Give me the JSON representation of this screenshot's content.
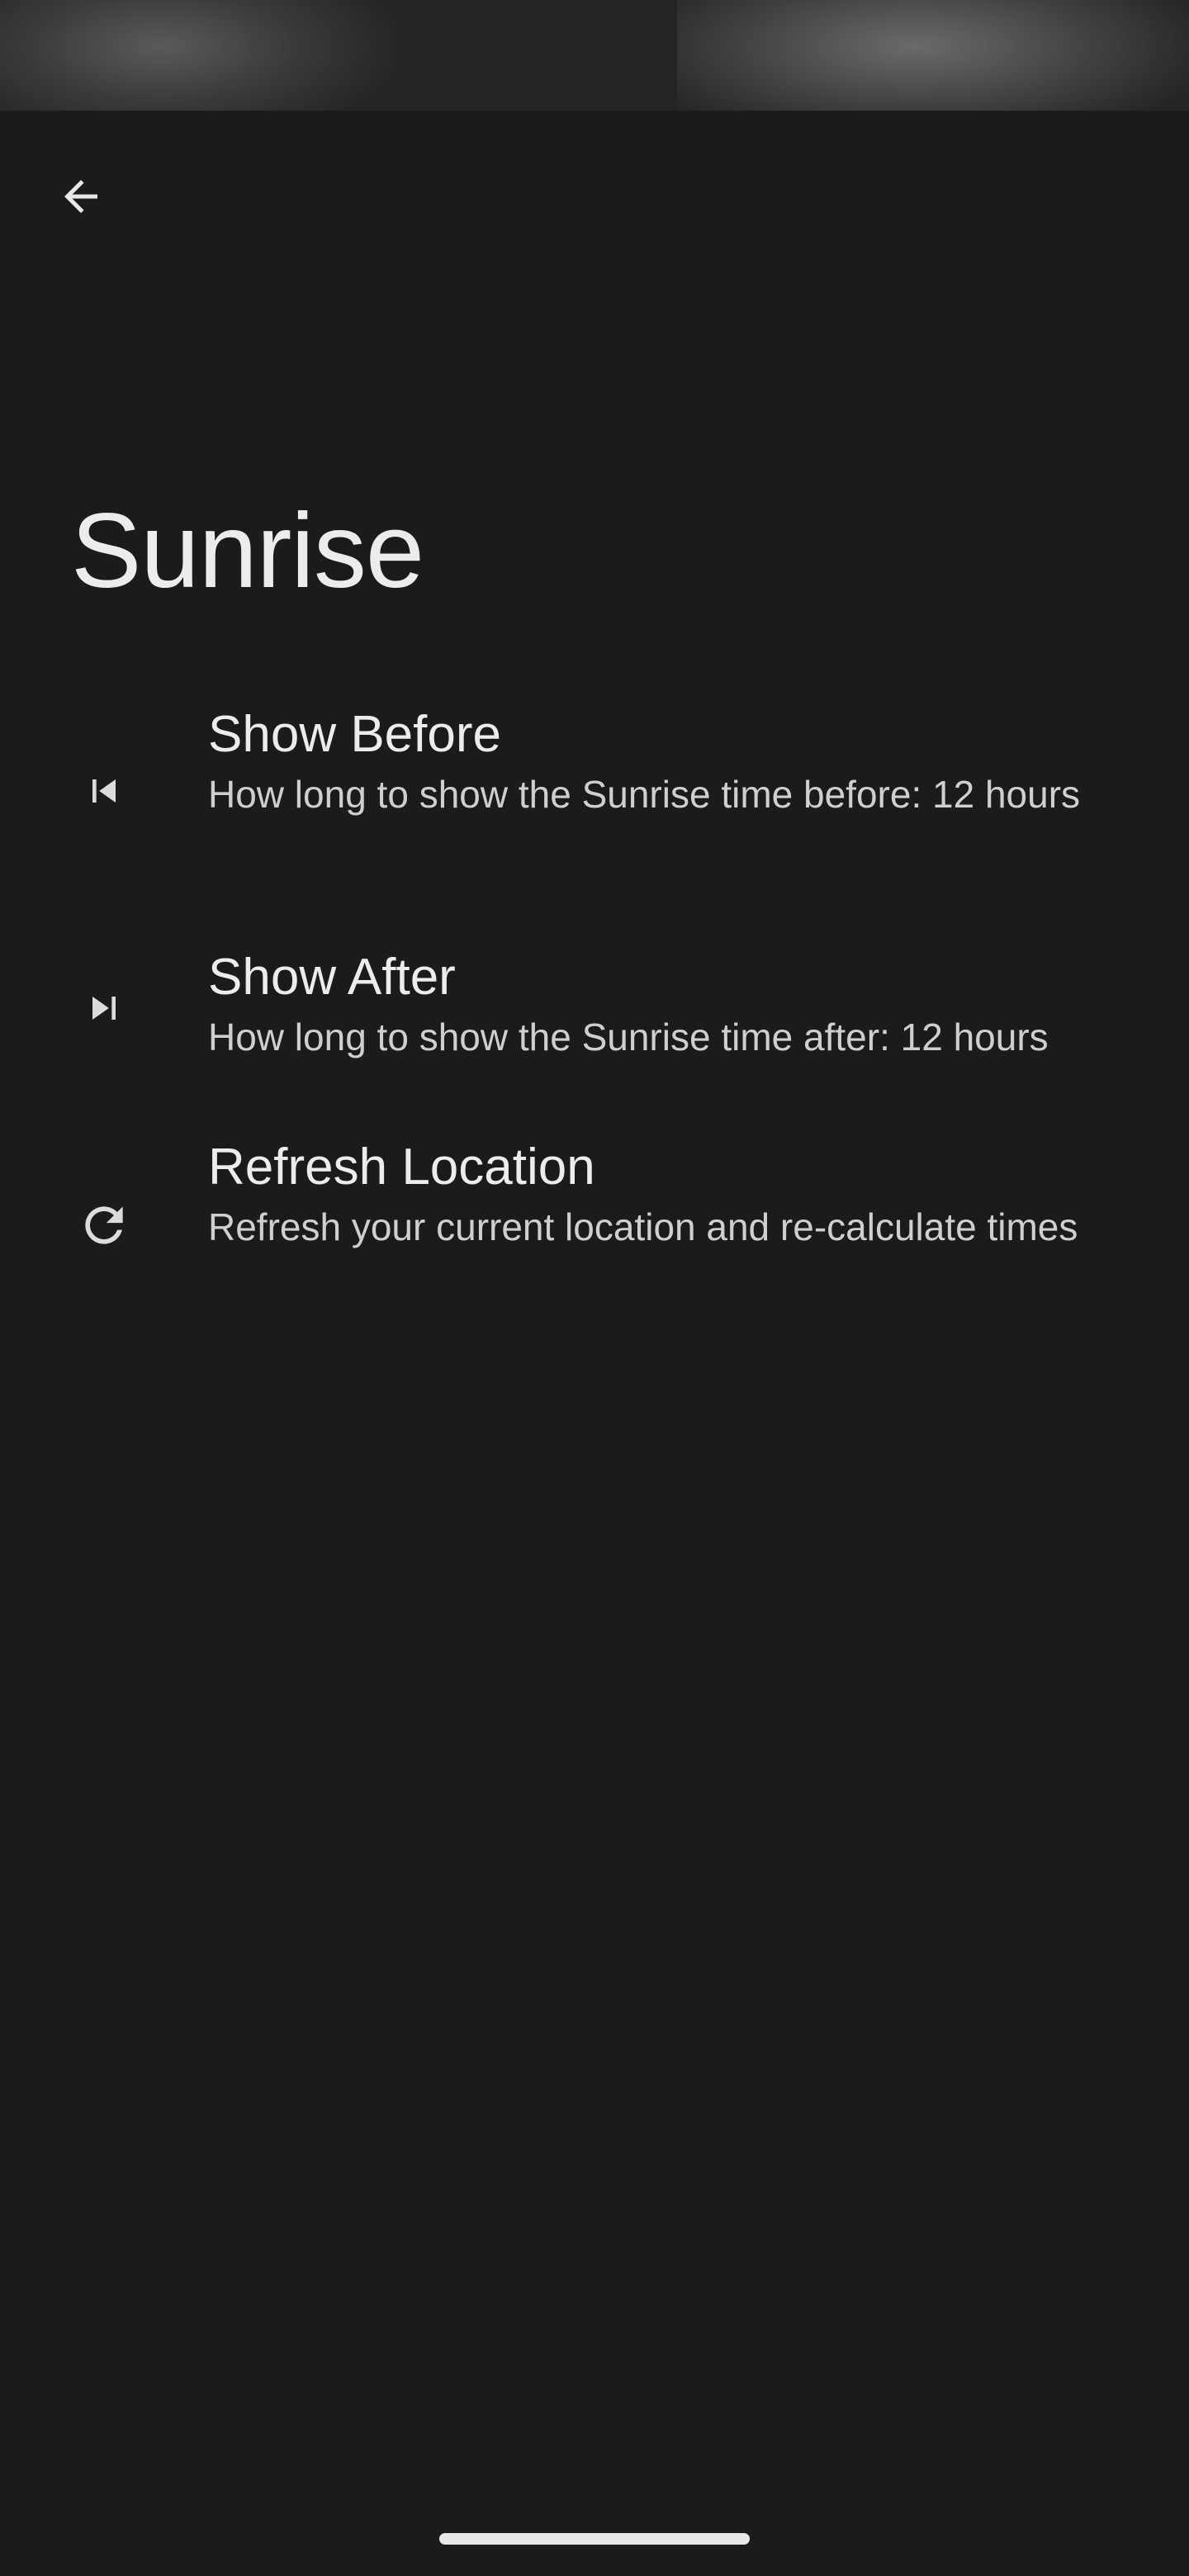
{
  "header": {
    "back_icon": "arrow-back-icon"
  },
  "page": {
    "title": "Sunrise"
  },
  "settings": {
    "items": [
      {
        "icon": "skip-previous-icon",
        "title": "Show Before",
        "summary": "How long to show the Sunrise time before: 12 hours"
      },
      {
        "icon": "skip-next-icon",
        "title": "Show After",
        "summary": "How long to show the Sunrise time after: 12 hours"
      },
      {
        "icon": "refresh-icon",
        "title": "Refresh Location",
        "summary": "Refresh your current location and re-calculate times"
      }
    ]
  },
  "colors": {
    "background": "#1b1b1b",
    "text_primary": "#ececec",
    "text_secondary": "#cfcfcf"
  }
}
